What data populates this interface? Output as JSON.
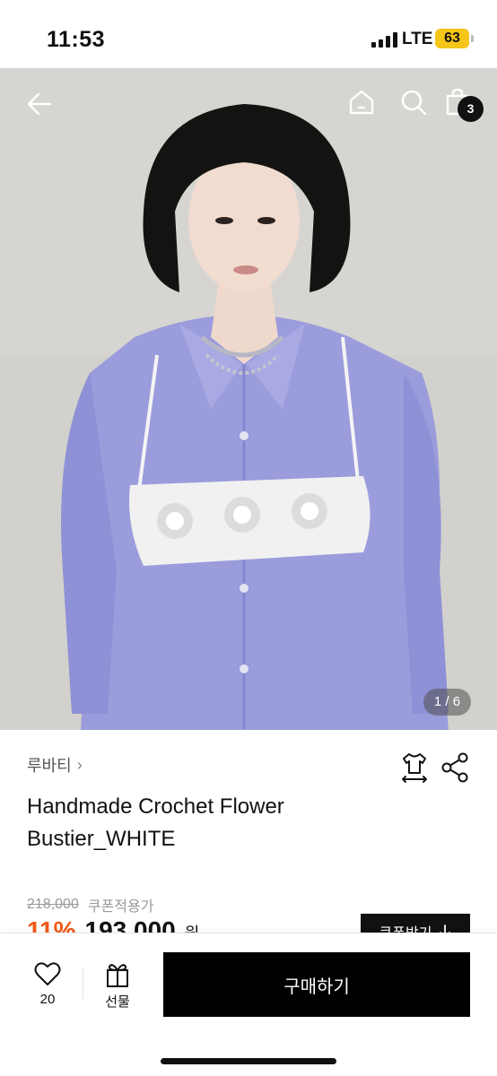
{
  "status_bar": {
    "time": "11:53",
    "network": "LTE",
    "battery": "63",
    "colors": {
      "battery": "#f5c518"
    }
  },
  "hero": {
    "icons": {
      "back": "arrow-left-icon",
      "home": "home-icon",
      "search": "search-icon",
      "bag": "shopping-bag-icon"
    },
    "cart_count": "3",
    "page_indicator": "1 / 6"
  },
  "product": {
    "brand": "루바티",
    "brand_chevron": "›",
    "title": "Handmade Crochet Flower Bustier_WHITE",
    "original_price": "218,000",
    "coupon_label": "쿠폰적용가",
    "discount": "11%",
    "price": "193,000",
    "currency": "원",
    "price_chevron": "⌄",
    "coupon_button": "쿠폰받기",
    "coupon_icon": "download-arrow-icon",
    "colors": {
      "discount": "#f05a1a"
    }
  },
  "bottom_bar": {
    "like_count": "20",
    "gift_label": "선물",
    "buy_label": "구매하기"
  }
}
